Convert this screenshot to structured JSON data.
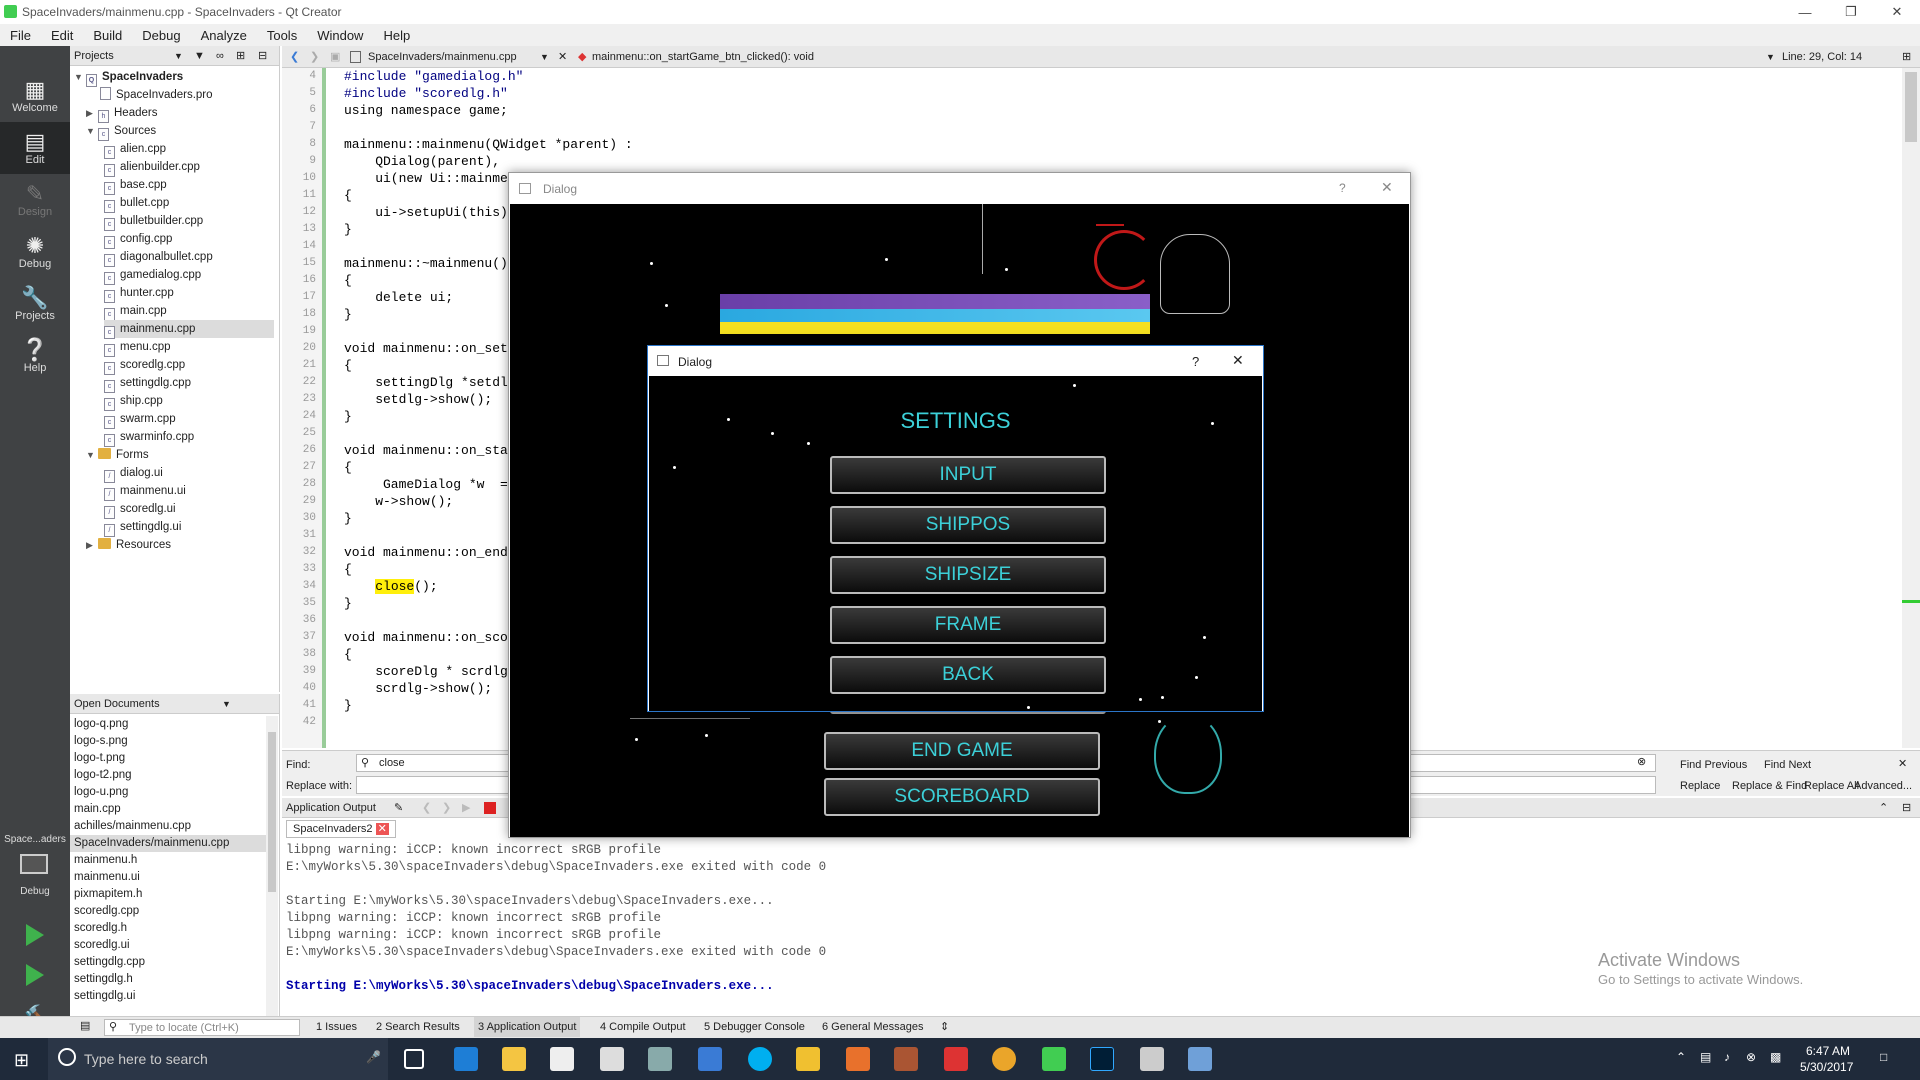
{
  "window": {
    "title": "SpaceInvaders/mainmenu.cpp - SpaceInvaders - Qt Creator"
  },
  "menu": [
    "File",
    "Edit",
    "Build",
    "Debug",
    "Analyze",
    "Tools",
    "Window",
    "Help"
  ],
  "modes": [
    {
      "label": "Welcome",
      "icon": "grid-icon"
    },
    {
      "label": "Edit",
      "icon": "edit-icon"
    },
    {
      "label": "Design",
      "icon": "pencil-icon"
    },
    {
      "label": "Debug",
      "icon": "bug-icon"
    },
    {
      "label": "Projects",
      "icon": "wrench-icon"
    },
    {
      "label": "Help",
      "icon": "help-icon"
    }
  ],
  "kit": {
    "label": "Space...aders",
    "sub": "Debug"
  },
  "projects": {
    "header": "Projects",
    "root": "SpaceInvaders",
    "pro": "SpaceInvaders.pro",
    "headers": "Headers",
    "sources": "Sources",
    "source_files": [
      "alien.cpp",
      "alienbuilder.cpp",
      "base.cpp",
      "bullet.cpp",
      "bulletbuilder.cpp",
      "config.cpp",
      "diagonalbullet.cpp",
      "gamedialog.cpp",
      "hunter.cpp",
      "main.cpp",
      "mainmenu.cpp",
      "menu.cpp",
      "scoredlg.cpp",
      "settingdlg.cpp",
      "ship.cpp",
      "swarm.cpp",
      "swarminfo.cpp"
    ],
    "forms": "Forms",
    "form_files": [
      "dialog.ui",
      "mainmenu.ui",
      "scoredlg.ui",
      "settingdlg.ui"
    ],
    "resources": "Resources"
  },
  "open_documents": {
    "header": "Open Documents",
    "files": [
      "logo-q.png",
      "logo-s.png",
      "logo-t.png",
      "logo-t2.png",
      "logo-u.png",
      "main.cpp",
      "achilles/mainmenu.cpp",
      "SpaceInvaders/mainmenu.cpp",
      "mainmenu.h",
      "mainmenu.ui",
      "pixmapitem.h",
      "scoredlg.cpp",
      "scoredlg.h",
      "scoredlg.ui",
      "settingdlg.cpp",
      "settingdlg.h",
      "settingdlg.ui"
    ]
  },
  "editor": {
    "file_tab": "SpaceInvaders/mainmenu.cpp",
    "function": "mainmenu::on_startGame_btn_clicked(): void",
    "position": "Line: 29, Col: 14",
    "lines": [
      {
        "n": "4",
        "t": "#include \"gamedialog.h\""
      },
      {
        "n": "5",
        "t": "#include \"scoredlg.h\""
      },
      {
        "n": "6",
        "t": "using namespace game;"
      },
      {
        "n": "7",
        "t": ""
      },
      {
        "n": "8",
        "t": "mainmenu::mainmenu(QWidget *parent) :"
      },
      {
        "n": "9",
        "t": "    QDialog(parent),"
      },
      {
        "n": "10",
        "t": "    ui(new Ui::mainme"
      },
      {
        "n": "11",
        "t": "{"
      },
      {
        "n": "12",
        "t": "    ui->setupUi(this)"
      },
      {
        "n": "13",
        "t": "}"
      },
      {
        "n": "14",
        "t": ""
      },
      {
        "n": "15",
        "t": "mainmenu::~mainmenu()"
      },
      {
        "n": "16",
        "t": "{"
      },
      {
        "n": "17",
        "t": "    delete ui;"
      },
      {
        "n": "18",
        "t": "}"
      },
      {
        "n": "19",
        "t": ""
      },
      {
        "n": "20",
        "t": "void mainmenu::on_set"
      },
      {
        "n": "21",
        "t": "{"
      },
      {
        "n": "22",
        "t": "    settingDlg *setdl"
      },
      {
        "n": "23",
        "t": "    setdlg->show();"
      },
      {
        "n": "24",
        "t": "}"
      },
      {
        "n": "25",
        "t": ""
      },
      {
        "n": "26",
        "t": "void mainmenu::on_sta"
      },
      {
        "n": "27",
        "t": "{"
      },
      {
        "n": "28",
        "t": "     GameDialog *w  ="
      },
      {
        "n": "29",
        "t": "    w->show();"
      },
      {
        "n": "30",
        "t": "}"
      },
      {
        "n": "31",
        "t": ""
      },
      {
        "n": "32",
        "t": "void mainmenu::on_end"
      },
      {
        "n": "33",
        "t": "{"
      },
      {
        "n": "34",
        "t": "    close();"
      },
      {
        "n": "35",
        "t": "}"
      },
      {
        "n": "36",
        "t": ""
      },
      {
        "n": "37",
        "t": "void mainmenu::on_sco"
      },
      {
        "n": "38",
        "t": "{"
      },
      {
        "n": "39",
        "t": "    scoreDlg * scrdlg"
      },
      {
        "n": "40",
        "t": "    scrdlg->show();"
      },
      {
        "n": "41",
        "t": "}"
      },
      {
        "n": "42",
        "t": ""
      }
    ]
  },
  "find": {
    "find_label": "Find:",
    "find_value": "close",
    "replace_label": "Replace with:",
    "find_prev": "Find Previous",
    "find_next": "Find Next",
    "replace": "Replace",
    "replace_find": "Replace & Find",
    "replace_all": "Replace All",
    "advanced": "Advanced..."
  },
  "output": {
    "header": "Application Output",
    "tab": "SpaceInvaders2",
    "lines": [
      "libpng warning: iCCP: known incorrect sRGB profile",
      "E:\\myWorks\\5.30\\spaceInvaders\\debug\\SpaceInvaders.exe exited with code 0",
      "",
      "Starting E:\\myWorks\\5.30\\spaceInvaders\\debug\\SpaceInvaders.exe...",
      "libpng warning: iCCP: known incorrect sRGB profile",
      "libpng warning: iCCP: known incorrect sRGB profile",
      "E:\\myWorks\\5.30\\spaceInvaders\\debug\\SpaceInvaders.exe exited with code 0",
      "",
      "Starting E:\\myWorks\\5.30\\spaceInvaders\\debug\\SpaceInvaders.exe..."
    ]
  },
  "status": {
    "locate_placeholder": "Type to locate (Ctrl+K)",
    "tabs": [
      "1  Issues",
      "2  Search Results",
      "3  Application Output",
      "4  Compile Output",
      "5  Debugger Console",
      "6  General Messages"
    ]
  },
  "watermark": {
    "title": "Activate Windows",
    "sub": "Go to Settings to activate Windows."
  },
  "taskbar": {
    "search": "Type here to search",
    "time": "6:47 AM",
    "date": "5/30/2017"
  },
  "game_dialog": {
    "title": "Dialog",
    "help": "?",
    "buttons": [
      "END GAME",
      "SCOREBOARD"
    ]
  },
  "settings_dialog": {
    "title": "Dialog",
    "help": "?",
    "heading": "SETTINGS",
    "buttons": [
      "INPUT",
      "SHIPPOS",
      "SHIPSIZE",
      "FRAME",
      "BACK"
    ]
  }
}
